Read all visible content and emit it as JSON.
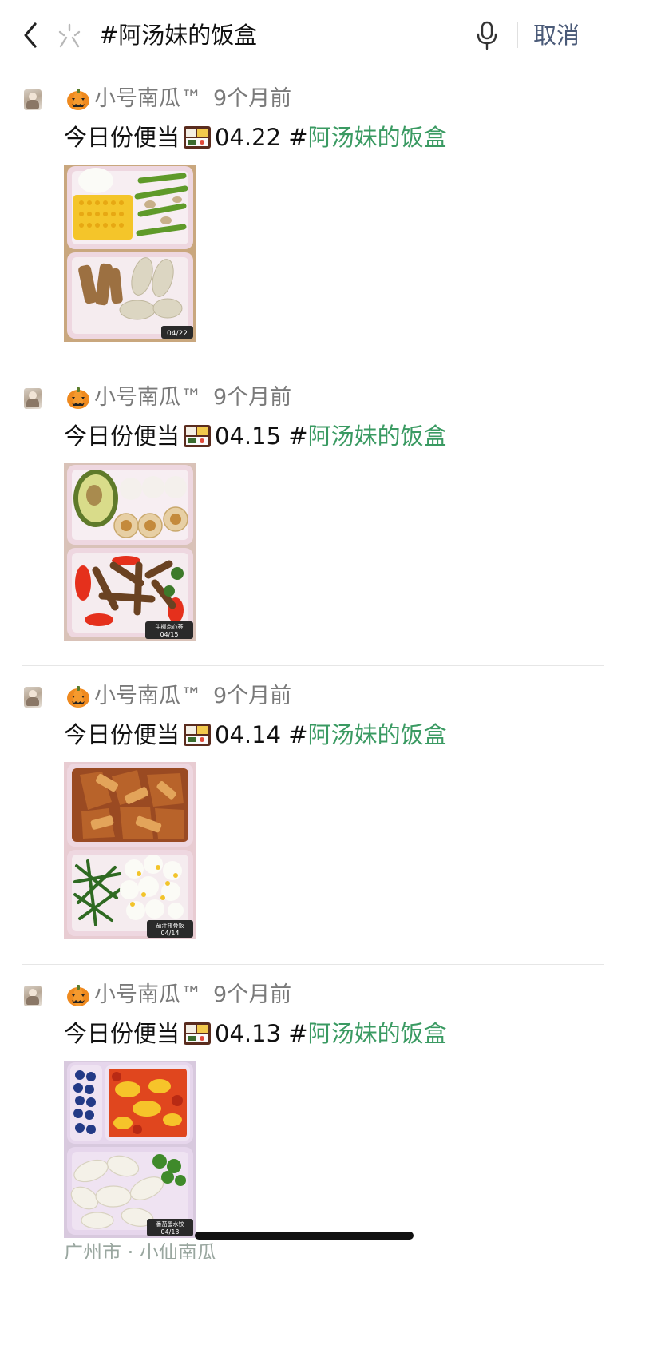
{
  "search": {
    "query": "#阿汤妹的饭盒",
    "cancel_label": "取消"
  },
  "posts": [
    {
      "author": "小号南瓜™",
      "time": "9个月前",
      "text": "今日份便当",
      "date": " 04.22 #",
      "tag": "阿汤妹的饭盒",
      "photo_caption": "04/22",
      "photo_subtitle": ""
    },
    {
      "author": "小号南瓜™",
      "time": "9个月前",
      "text": "今日份便当",
      "date": "04.15 #",
      "tag": "阿汤妹的饭盒",
      "photo_caption": "04/15",
      "photo_subtitle": "牛柳点心荟"
    },
    {
      "author": "小号南瓜™",
      "time": "9个月前",
      "text": "今日份便当",
      "date": "04.14 #",
      "tag": "阿汤妹的饭盒",
      "photo_caption": "04/14",
      "photo_subtitle": "茄汁排骨饭"
    },
    {
      "author": "小号南瓜™",
      "time": "9个月前",
      "text": "今日份便当",
      "date": " 04.13 #",
      "tag": "阿汤妹的饭盒",
      "photo_caption": "04/13",
      "photo_subtitle": "番茄蛋水饺"
    }
  ],
  "footer": {
    "partial_text": "广州市 · 小仙南瓜"
  },
  "colors": {
    "tag_green": "#3a9a62",
    "cancel_blue_gray": "#4a5a78",
    "meta_gray": "#7a7a7a",
    "box_pink": "#eed7e0"
  },
  "icons": {
    "back": "chevron-left-icon",
    "logo": "miniprogram-icon",
    "mic": "microphone-icon",
    "author_emoji": "pumpkin-icon",
    "bento_emoji": "bento-box-icon"
  }
}
